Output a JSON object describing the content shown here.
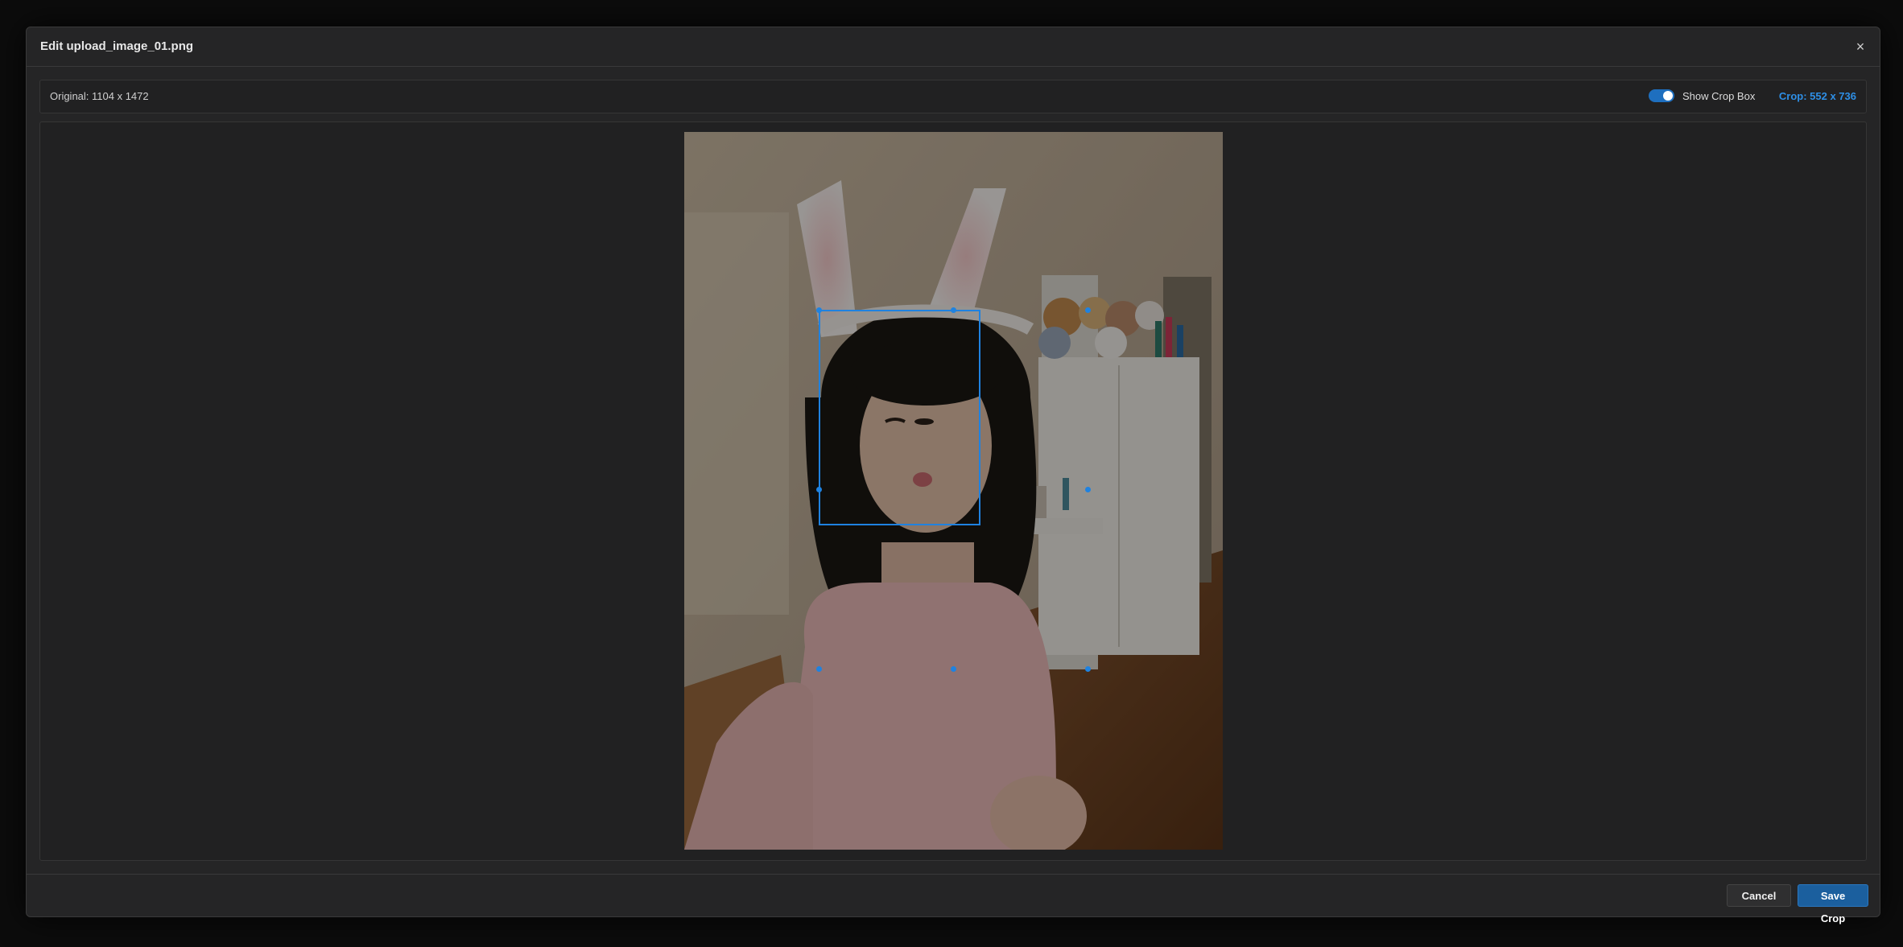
{
  "modal": {
    "title": "Edit upload_image_01.png",
    "close_label": "×"
  },
  "info_bar": {
    "original_label": "Original: 1104 x 1472",
    "show_crop_box_label": "Show Crop Box",
    "show_crop_box_enabled": true,
    "crop_readout": "Crop: 552 x 736"
  },
  "image": {
    "original_width": 1104,
    "original_height": 1472,
    "crop_width": 552,
    "crop_height": 736
  },
  "footer": {
    "cancel_label": "Cancel",
    "save_label": "Save Crop"
  },
  "colors": {
    "accent": "#1f82e0",
    "save_button": "#1b5f9e",
    "modal_bg": "#252526"
  }
}
